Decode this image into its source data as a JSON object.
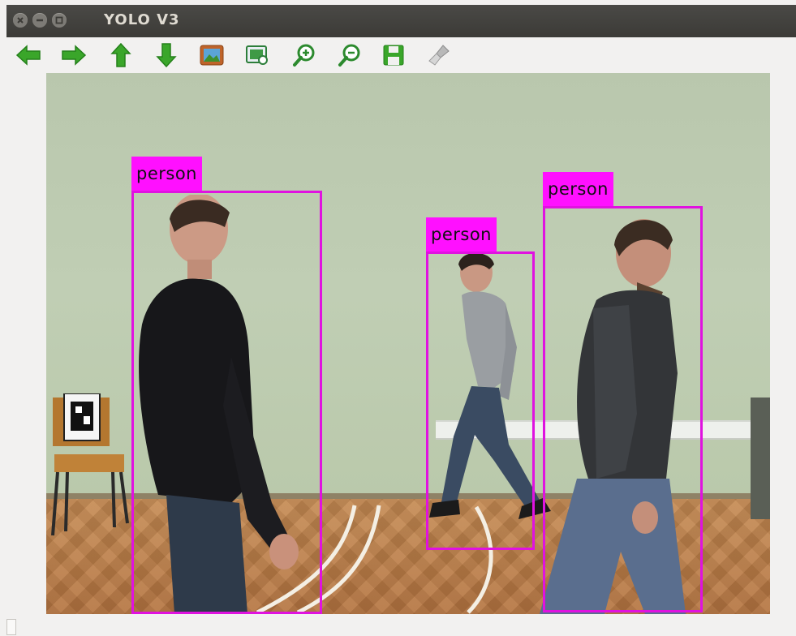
{
  "window": {
    "title": "YOLO V3",
    "controls": [
      "close-icon",
      "minimize-icon",
      "maximize-icon"
    ]
  },
  "toolbar": {
    "buttons": [
      {
        "icon": "arrow-left-icon"
      },
      {
        "icon": "arrow-right-icon"
      },
      {
        "icon": "arrow-up-icon"
      },
      {
        "icon": "arrow-down-icon"
      },
      {
        "icon": "image-icon"
      },
      {
        "icon": "screenshot-icon"
      },
      {
        "icon": "zoom-in-icon"
      },
      {
        "icon": "zoom-out-icon"
      },
      {
        "icon": "save-icon"
      },
      {
        "icon": "clear-brush-icon"
      }
    ]
  },
  "detections": [
    {
      "label": "person"
    },
    {
      "label": "person"
    },
    {
      "label": "person"
    }
  ],
  "colors": {
    "box": "#e012e0",
    "label_bg": "#ff10ff",
    "icon_green": "#3aa62a",
    "titlebar": "#3c3b37"
  }
}
